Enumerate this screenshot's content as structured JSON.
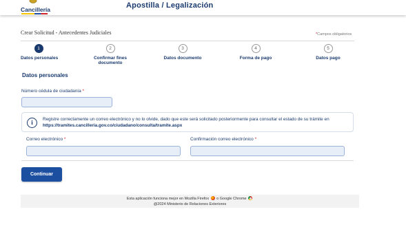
{
  "header": {
    "logo_text": "Cancillería",
    "app_title": "Apostilla / Legalización",
    "brand_color": "#1a3a6e"
  },
  "form": {
    "title": "Crear Solicitud - Antecedentes Judiciales",
    "required_star": "*",
    "required_note": "Campos obligatorios"
  },
  "steps": [
    {
      "number": "1",
      "label": "Datos personales",
      "active": true
    },
    {
      "number": "2",
      "label": "Confirmar fines documento",
      "active": false
    },
    {
      "number": "3",
      "label": "Datos documento",
      "active": false
    },
    {
      "number": "4",
      "label": "Forma de pago",
      "active": false
    },
    {
      "number": "5",
      "label": "Datos pago",
      "active": false
    }
  ],
  "section": {
    "title": "Datos personales"
  },
  "fields": {
    "cedula": {
      "label": "Número cédula de ciudadanía",
      "star": "*",
      "value": ""
    },
    "email": {
      "label": "Correo electrónico",
      "star": "*",
      "value": ""
    },
    "email_confirm": {
      "label": "Confirmación correo electrónico",
      "star": "*",
      "value": ""
    }
  },
  "info": {
    "icon": "info-icon",
    "text": "Registre correctamente un correo electrónico y no lo olvide, dado que este será solicitado posteriormente para consultar el estado de su trámite en",
    "link": "https://tramites.cancilleria.gov.co/ciudadano/consulta/tramite.aspx"
  },
  "actions": {
    "continue_label": "Continuar",
    "button_color": "#1d4fa0"
  },
  "footer": {
    "browser_prefix": "Esta aplicación funciona mejor en Mozilla Firefox",
    "browser_joiner": "o Google Chrome",
    "copyright": "@2024 Ministerio de Relaciones Exteriores"
  }
}
